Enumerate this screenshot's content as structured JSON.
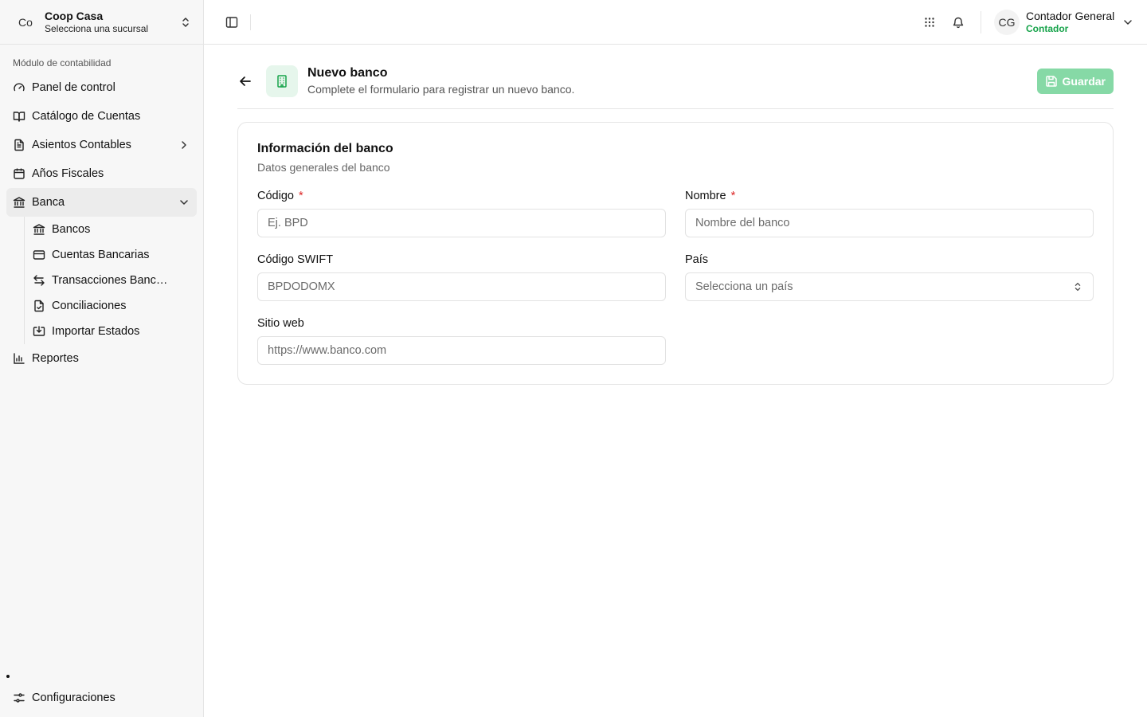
{
  "sidebar": {
    "org": {
      "avatar": "Co",
      "name": "Coop Casa",
      "subtitle": "Selecciona una sucursal"
    },
    "section_label": "Módulo de contabilidad",
    "items": [
      {
        "label": "Panel de control",
        "icon": "gauge-icon"
      },
      {
        "label": "Catálogo de Cuentas",
        "icon": "book-open-icon"
      },
      {
        "label": "Asientos Contables",
        "icon": "file-text-icon"
      },
      {
        "label": "Años Fiscales",
        "icon": "calendar-icon"
      },
      {
        "label": "Banca",
        "icon": "landmark-icon"
      }
    ],
    "banca_sub": [
      {
        "label": "Bancos",
        "icon": "landmark-icon"
      },
      {
        "label": "Cuentas Bancarias",
        "icon": "credit-card-icon"
      },
      {
        "label": "Transacciones Bancarias",
        "icon": "arrows-left-right-icon"
      },
      {
        "label": "Conciliaciones",
        "icon": "file-check-icon"
      },
      {
        "label": "Importar Estados",
        "icon": "import-icon"
      }
    ],
    "reportes": {
      "label": "Reportes",
      "icon": "bar-chart-icon"
    },
    "settings": {
      "label": "Configuraciones",
      "icon": "sliders-icon"
    }
  },
  "topbar": {
    "user": {
      "initials": "CG",
      "name": "Contador General",
      "role": "Contador"
    }
  },
  "page": {
    "title": "Nuevo banco",
    "subtitle": "Complete el formulario para registrar un nuevo banco.",
    "save_label": "Guardar"
  },
  "card": {
    "title": "Información del banco",
    "subtitle": "Datos generales del banco",
    "fields": {
      "codigo": {
        "label": "Código",
        "required_mark": "*",
        "placeholder": "Ej. BPD",
        "value": ""
      },
      "nombre": {
        "label": "Nombre",
        "required_mark": "*",
        "placeholder": "Nombre del banco",
        "value": ""
      },
      "swift": {
        "label": "Código SWIFT",
        "placeholder": "BPDODOMX",
        "value": ""
      },
      "pais": {
        "label": "País",
        "placeholder": "Selecciona un país"
      },
      "web": {
        "label": "Sitio web",
        "placeholder": "https://www.banco.com",
        "value": ""
      }
    }
  },
  "colors": {
    "accent": "#16a34a",
    "accent_soft": "#e6f6ec",
    "save_disabled": "#86d9a6",
    "required": "#dc2626"
  }
}
